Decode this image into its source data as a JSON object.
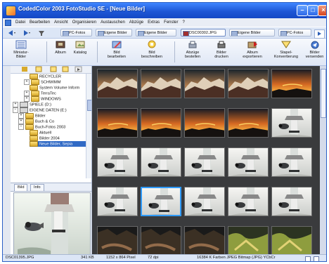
{
  "app": {
    "title": "CodedColor 2003 FotoStudio SE - [Neue Bilder]",
    "window_buttons": [
      "–",
      "□",
      "×"
    ]
  },
  "menu": [
    "Datei",
    "Bearbeiten",
    "Ansicht",
    "Organisieren",
    "Austauschen",
    "Abzüge",
    "Extras",
    "Fenster",
    "?"
  ],
  "navigation": {
    "tabs": [
      {
        "label": "PC-Fotos",
        "active": false
      },
      {
        "label": "Eigene Bilder",
        "active": false
      },
      {
        "label": "Eigene Bilder",
        "active": false
      },
      {
        "label": "DSC00302.JPG",
        "active": true
      },
      {
        "label": "Eigene Bilder",
        "active": false
      },
      {
        "label": "PC-Fotos",
        "active": false
      }
    ]
  },
  "toolbar": {
    "buttons": [
      {
        "label": "Miniatur-\nBilder",
        "icon": "thumbnail-view-icon"
      },
      {
        "label": "Album",
        "icon": "album-icon"
      },
      {
        "label": "Katalog",
        "icon": "catalog-icon"
      },
      {
        "label": "Bild\nbearbeiten",
        "icon": "edit-image-icon"
      },
      {
        "label": "Bild\nbeschreiben",
        "icon": "describe-image-icon"
      },
      {
        "label": "Abzüge\nbestellen",
        "icon": "order-prints-icon"
      },
      {
        "label": "Bilder\ndrucken",
        "icon": "print-images-icon"
      },
      {
        "label": "Album\nexportieren",
        "icon": "export-album-icon"
      },
      {
        "label": "Stapel-\nKonvertierung",
        "icon": "batch-convert-icon"
      },
      {
        "label": "Bilder\nversenden",
        "icon": "send-images-icon"
      }
    ]
  },
  "tree": {
    "items": [
      {
        "label": "RECYCLER",
        "type": "folder",
        "expanded": false,
        "selected": false
      },
      {
        "label": "SCHWIMM",
        "type": "folder",
        "expanded": true,
        "selected": false
      },
      {
        "label": "System Volume Inform",
        "type": "folder",
        "expanded": false,
        "selected": false
      },
      {
        "label": "TerraTec",
        "type": "folder",
        "expanded": true,
        "selected": false
      },
      {
        "label": "WINDOWS",
        "type": "folder",
        "expanded": true,
        "selected": false
      },
      {
        "label": "SPIELE (D:)",
        "type": "drive",
        "expanded": true,
        "selected": false
      },
      {
        "label": "EIGENE DATEN (E:)",
        "type": "drive",
        "expanded": false,
        "selected": false
      },
      {
        "label": "Bilder",
        "type": "folder",
        "expanded": true,
        "selected": false
      },
      {
        "label": "Buch & Co",
        "type": "folder",
        "expanded": true,
        "selected": false
      },
      {
        "label": "Buch-Fotos 2003",
        "type": "folder",
        "expanded": false,
        "selected": false
      },
      {
        "label": "Aktuell",
        "type": "folder",
        "expanded": false,
        "selected": false
      },
      {
        "label": "Bilder 2004",
        "type": "folder",
        "expanded": false,
        "selected": false
      },
      {
        "label": "Neue Bilder, Sepia",
        "type": "folder",
        "expanded": false,
        "selected": true
      }
    ]
  },
  "preview": {
    "tabs": [
      {
        "label": "Bild",
        "active": true
      },
      {
        "label": "Info",
        "active": false
      }
    ]
  },
  "gallery": {
    "thumbnails": [
      {
        "kind": "mountain"
      },
      {
        "kind": "mountain"
      },
      {
        "kind": "mountain"
      },
      {
        "kind": "mountain"
      },
      {
        "kind": "sunset"
      },
      {
        "kind": "sunset"
      },
      {
        "kind": "sunset"
      },
      {
        "kind": "sunset"
      },
      {
        "kind": "sunset"
      },
      {
        "kind": "bird-feeder"
      },
      {
        "kind": "bird-feeder"
      },
      {
        "kind": "bird-feeder"
      },
      {
        "kind": "bird-feeder"
      },
      {
        "kind": "bird-feeder"
      },
      {
        "kind": "bird-feeder"
      },
      {
        "kind": "bird-feeder"
      },
      {
        "kind": "bird-feeder",
        "selected": true
      },
      {
        "kind": "bird-feeder"
      },
      {
        "kind": "bird-feeder"
      },
      {
        "kind": "bird-feeder"
      },
      {
        "kind": "partial-dark"
      },
      {
        "kind": "partial-dark"
      },
      {
        "kind": "partial-dark"
      },
      {
        "kind": "partial-green"
      },
      {
        "kind": "partial-green"
      }
    ]
  },
  "status": {
    "filename": "DSC01395.JPG",
    "filesize": "341 KB",
    "dimensions": "1152 x 864 Pixel",
    "dpi": "72 dpi",
    "format": "16384 K Farben JPEG Bitmap (JPG) YCbCr"
  },
  "colors": {
    "title_bar": "#1e57d6",
    "selected": "#316ac5",
    "gallery_background": "#3a3b3d"
  }
}
